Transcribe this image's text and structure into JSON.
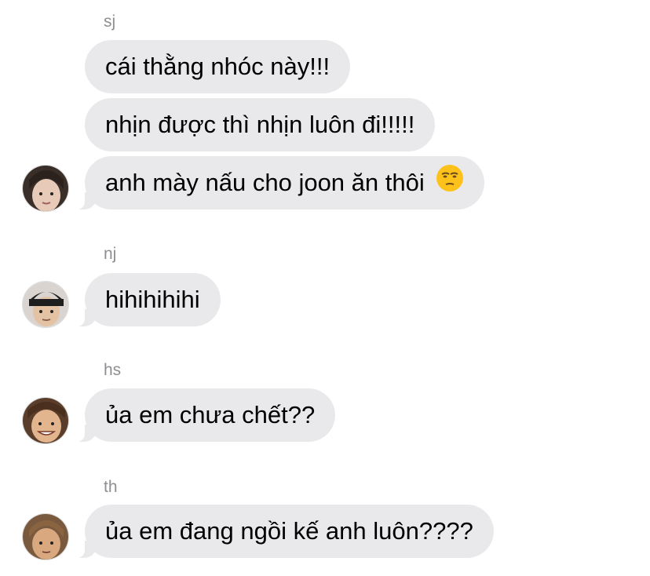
{
  "groups": [
    {
      "sender": "sj",
      "messages": [
        "cái thằng nhóc này!!!",
        "nhịn được thì nhịn luôn đi!!!!!",
        "anh mày nấu cho joon ăn thôi"
      ],
      "last_emoji": "unamused-face-icon"
    },
    {
      "sender": "nj",
      "messages": [
        "hihihihihi"
      ]
    },
    {
      "sender": "hs",
      "messages": [
        "ủa em chưa chết??"
      ]
    },
    {
      "sender": "th",
      "messages": [
        "ủa em đang ngồi kế anh luôn????"
      ]
    }
  ],
  "colors": {
    "bubble": "#e9e9eb",
    "sender_text": "#8e8e93",
    "background": "#ffffff"
  }
}
